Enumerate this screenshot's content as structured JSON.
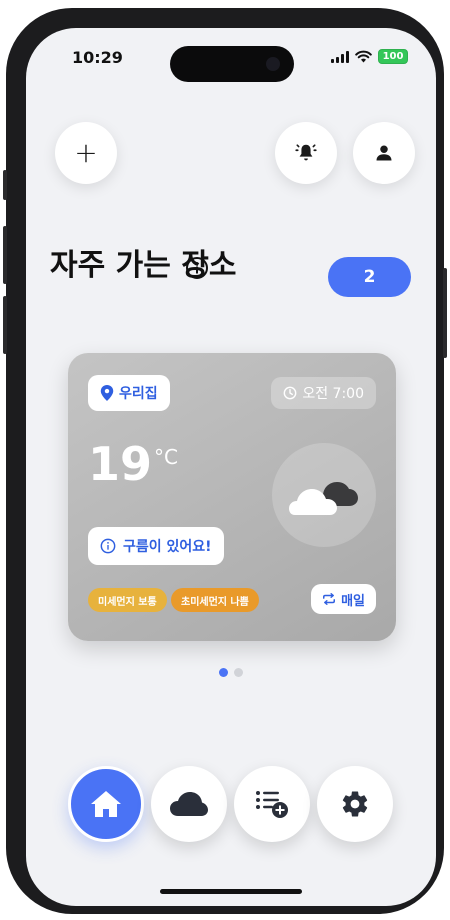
{
  "status": {
    "time": "10:29",
    "battery": "100"
  },
  "header": {
    "title": "자주 가는 장소",
    "count": "2"
  },
  "card": {
    "location": "우리집",
    "time": "오전 7:00",
    "temperature": "19",
    "unit": "°C",
    "message": "구름이 있어요!",
    "fine_dust": "미세먼지 보통",
    "ultra_fine_dust": "초미세먼지 나쁨",
    "repeat": "매일",
    "colors": {
      "fine_dust": "#e7b23d",
      "ultra_fine_dust": "#e99a2a",
      "accent": "#2f5fe0"
    }
  },
  "pagination": {
    "total": 2,
    "active": 1
  },
  "nav": {
    "items": [
      {
        "icon": "home-icon",
        "active": true
      },
      {
        "icon": "cloud-icon",
        "active": false
      },
      {
        "icon": "list-add-icon",
        "active": false
      },
      {
        "icon": "gear-icon",
        "active": false
      }
    ]
  },
  "colors": {
    "primary": "#4a73f5",
    "background": "#f1f2f5"
  }
}
